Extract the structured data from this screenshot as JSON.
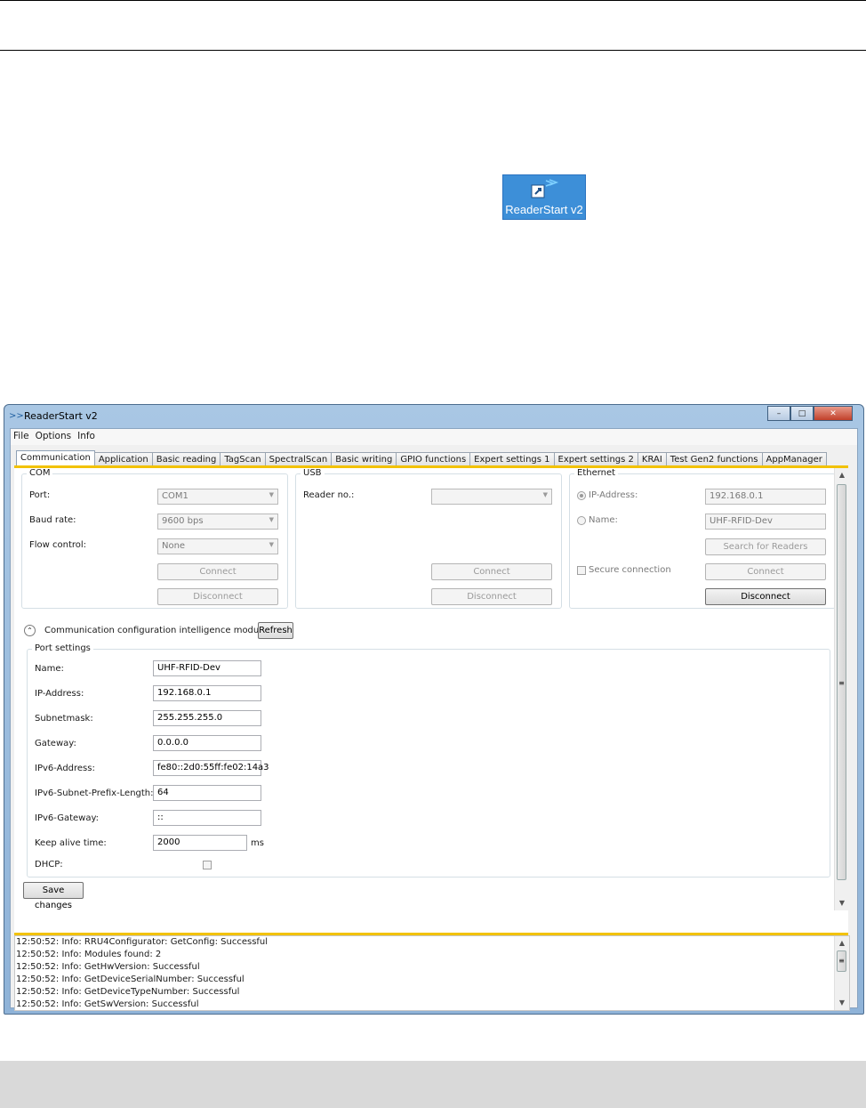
{
  "desktop": {
    "shortcut_label": "ReaderStart v2"
  },
  "window": {
    "title": "ReaderStart v2",
    "controls": {
      "minimize": "–",
      "maximize": "□",
      "close": "✕"
    }
  },
  "menu": [
    "File",
    "Options",
    "Info"
  ],
  "tabs": [
    "Communication",
    "Application",
    "Basic reading",
    "TagScan",
    "SpectralScan",
    "Basic writing",
    "GPIO functions",
    "Expert settings 1",
    "Expert settings 2",
    "KRAI",
    "Test Gen2 functions",
    "AppManager"
  ],
  "com": {
    "title": "COM",
    "port_label": "Port:",
    "port_value": "COM1",
    "baud_label": "Baud rate:",
    "baud_value": "9600 bps",
    "flow_label": "Flow control:",
    "flow_value": "None",
    "connect": "Connect",
    "disconnect": "Disconnect"
  },
  "usb": {
    "title": "USB",
    "reader_label": "Reader no.:",
    "reader_value": "",
    "connect": "Connect",
    "disconnect": "Disconnect"
  },
  "ethernet": {
    "title": "Ethernet",
    "ip_label": "IP-Address:",
    "ip_value": "192.168.0.1",
    "name_label": "Name:",
    "name_value": "UHF-RFID-Dev",
    "search": "Search for Readers",
    "secure_label": "Secure connection",
    "connect": "Connect",
    "disconnect": "Disconnect"
  },
  "module": {
    "title": "Communication configuration intelligence module",
    "refresh": "Refresh"
  },
  "port_settings": {
    "title": "Port settings",
    "fields": [
      {
        "label": "Name:",
        "value": "UHF-RFID-Dev"
      },
      {
        "label": "IP-Address:",
        "value": "192.168.0.1"
      },
      {
        "label": "Subnetmask:",
        "value": "255.255.255.0"
      },
      {
        "label": "Gateway:",
        "value": "0.0.0.0"
      },
      {
        "label": "IPv6-Address:",
        "value": "fe80::2d0:55ff:fe02:14a3"
      },
      {
        "label": "IPv6-Subnet-Prefix-Length:",
        "value": "64"
      },
      {
        "label": "IPv6-Gateway:",
        "value": "::"
      },
      {
        "label": "Keep alive time:",
        "value": "2000"
      }
    ],
    "keep_alive_unit": "ms",
    "dhcp_label": "DHCP:"
  },
  "save_changes": "Save changes",
  "log": [
    "12:50:52: Info: RRU4Configurator: GetConfig: Successful",
    "12:50:52: Info: Modules found: 2",
    "12:50:52: Info: GetHwVersion: Successful",
    "12:50:52: Info: GetDeviceSerialNumber: Successful",
    "12:50:52: Info: GetDeviceTypeNumber: Successful",
    "12:50:52: Info: GetSwVersion: Successful"
  ]
}
